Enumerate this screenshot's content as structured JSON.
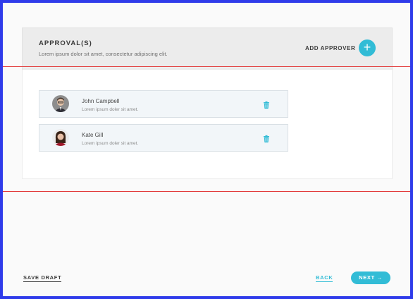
{
  "section": {
    "title": "APPROVAL(S)",
    "subtitle": "Lorem ipsum dolor sit amet, consectetur adipiscing elit.",
    "add_label": "ADD APPROVER",
    "add_icon": "+"
  },
  "approvers": [
    {
      "name": "John Campbell",
      "description": "Lorem ipsum doler sit amet."
    },
    {
      "name": "Kate Gill",
      "description": "Lorem ipsum doler sit amet."
    }
  ],
  "footer": {
    "save_draft": "SAVE DRAFT",
    "back": "BACK",
    "next": "NEXT →"
  },
  "colors": {
    "accent": "#32bcd6",
    "frame": "#2f3bea",
    "guide_line": "#e23a3a"
  }
}
